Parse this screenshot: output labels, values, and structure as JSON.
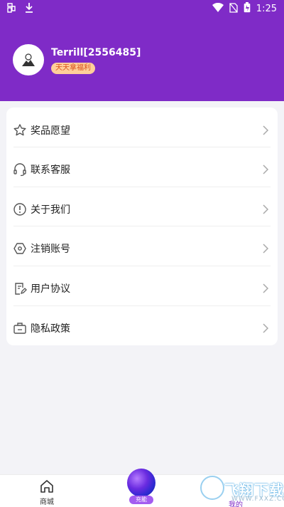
{
  "status_bar": {
    "time": "1:25"
  },
  "profile": {
    "username": "Terrill[2556485]",
    "tag": "天天拿福利"
  },
  "menu": [
    {
      "label": "奖品愿望",
      "icon": "star-icon"
    },
    {
      "label": "联系客服",
      "icon": "headset-icon"
    },
    {
      "label": "关于我们",
      "icon": "info-icon"
    },
    {
      "label": "注销账号",
      "icon": "hexagon-icon"
    },
    {
      "label": "用户协议",
      "icon": "document-edit-icon"
    },
    {
      "label": "隐私政策",
      "icon": "briefcase-icon"
    }
  ],
  "tabbar": {
    "home_label": "商城",
    "center_label": "充能",
    "me_label": "我的"
  },
  "watermark": {
    "text": "飞翔下载",
    "url": "WWW.FXXZ.COM"
  },
  "colors": {
    "header": "#7f2bc7",
    "tag_bg": "#ffcf9a",
    "tag_text": "#d9531e"
  }
}
